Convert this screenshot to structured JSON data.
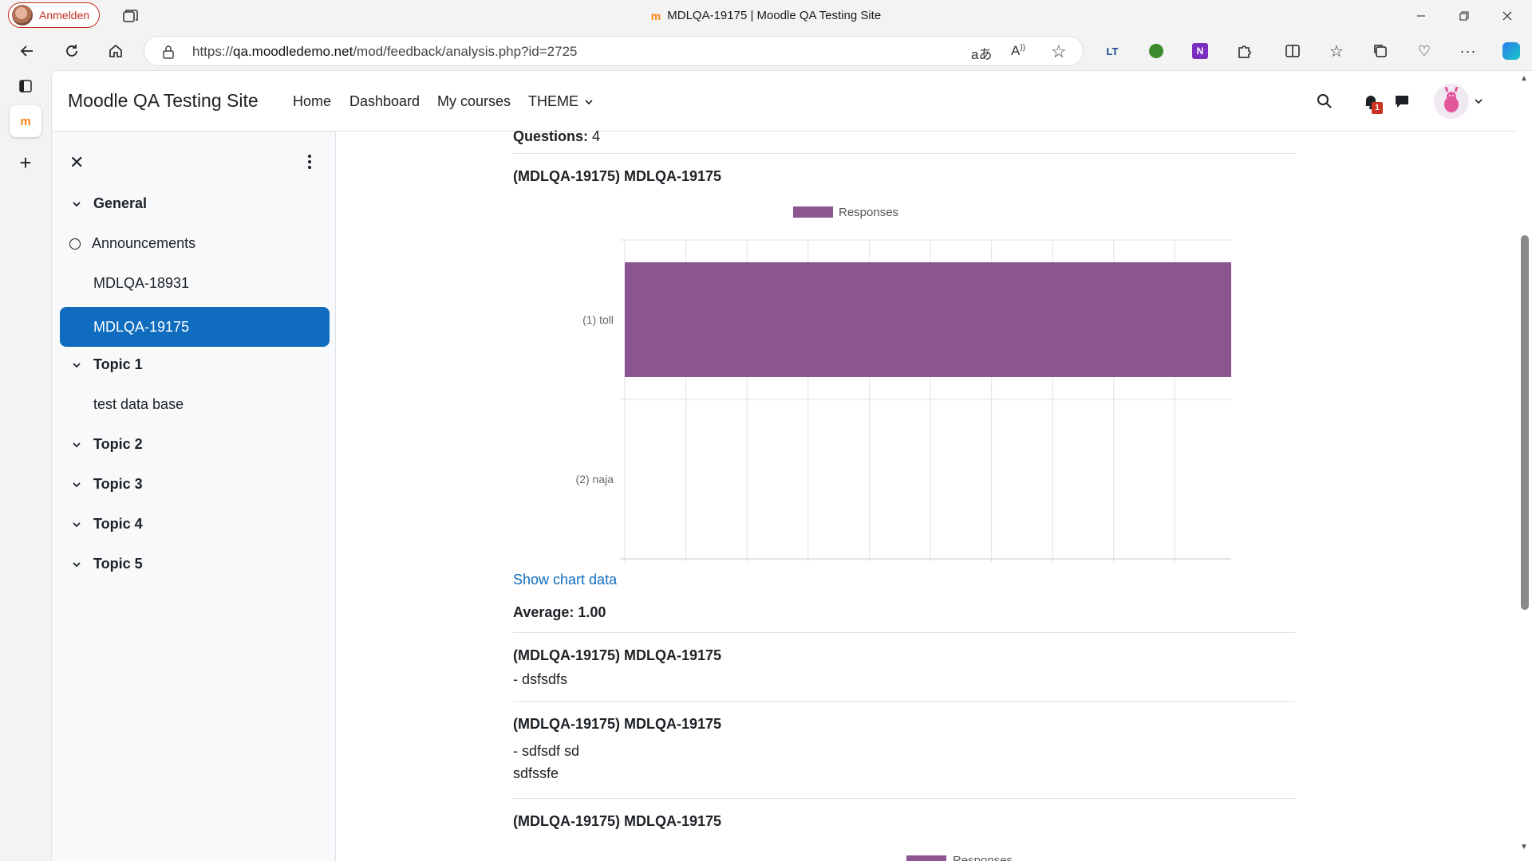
{
  "browser": {
    "profile_label": "Anmelden",
    "window_title": "MDLQA-19175 | Moodle QA Testing Site",
    "url_prefix": "https://",
    "url_host": "qa.moodledemo.net",
    "url_path": "/mod/feedback/analysis.php?id=2725"
  },
  "navbar": {
    "site_name": "Moodle QA Testing Site",
    "links": [
      "Home",
      "Dashboard",
      "My courses",
      "THEME"
    ],
    "notification_count": "1"
  },
  "drawer": {
    "sections": [
      {
        "label": "General",
        "items": [
          "Announcements",
          "MDLQA-18931",
          "MDLQA-19175"
        ]
      },
      {
        "label": "Topic 1",
        "items": [
          "test data base"
        ]
      },
      {
        "label": "Topic 2",
        "items": []
      },
      {
        "label": "Topic 3",
        "items": []
      },
      {
        "label": "Topic 4",
        "items": []
      },
      {
        "label": "Topic 5",
        "items": []
      }
    ],
    "active_item": "MDLQA-19175"
  },
  "main": {
    "questions_label": "Questions:",
    "questions_count": "4",
    "q1_title": "(MDLQA-19175) MDLQA-19175",
    "show_chart_data": "Show chart data",
    "average": "Average: 1.00",
    "q2_title": "(MDLQA-19175) MDLQA-19175",
    "q2_answer": "- dsfsdfs",
    "q3_title": "(MDLQA-19175) MDLQA-19175",
    "q3_answer_line1": "- sdfsdf sd",
    "q3_answer_line2": "sdfssfe",
    "q4_title": "(MDLQA-19175) MDLQA-19175",
    "q4_legend_partial": "Responses",
    "help": "?"
  },
  "chart_data": {
    "type": "bar",
    "orientation": "horizontal",
    "categories": [
      "(1) toll",
      "(2) naja"
    ],
    "series": [
      {
        "name": "Responses",
        "values": [
          1,
          0
        ],
        "color": "#8a5591"
      }
    ],
    "xlim": [
      0,
      1
    ],
    "xticks": [
      "0",
      "0,1",
      "0,2",
      "0,3",
      "0,4",
      "0,5",
      "0,6",
      "0,7",
      "0,8",
      "0,9",
      "1,0"
    ],
    "grid": true,
    "legend": "top"
  },
  "colors": {
    "accent": "#0f6cbf",
    "bar": "#8a5591",
    "badge": "#ca3120"
  }
}
